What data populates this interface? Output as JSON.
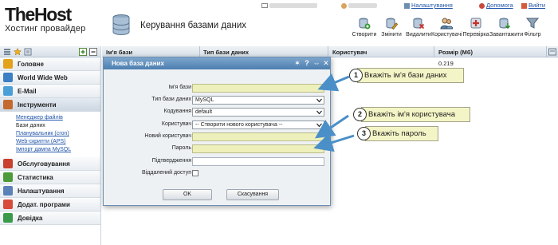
{
  "app": {
    "logo_title": "TheHost",
    "logo_subtitle": "Хостинг провайдер",
    "page_title": "Керування базами даних"
  },
  "topbar": {
    "settings": "Налаштування",
    "help": "Допомога",
    "exit": "Вийти"
  },
  "toolbar": {
    "buttons": [
      {
        "label": "Створити",
        "icon": "create-icon"
      },
      {
        "label": "Змінити",
        "icon": "edit-icon"
      },
      {
        "label": "Видалити",
        "icon": "delete-icon"
      },
      {
        "label": "Користувачі",
        "icon": "users-icon"
      },
      {
        "label": "Перевірка",
        "icon": "check-icon"
      },
      {
        "label": "Завантажити",
        "icon": "download-icon"
      },
      {
        "label": "Фільтр",
        "icon": "filter-icon"
      }
    ]
  },
  "sidebar": {
    "groups": [
      {
        "label": "Головне",
        "color": "#e3a21a"
      },
      {
        "label": "World Wide Web",
        "color": "#3b7fc4"
      },
      {
        "label": "E-Mail",
        "color": "#4a9fd8"
      },
      {
        "label": "Інструменти",
        "color": "#c46a2e"
      }
    ],
    "tools_items": [
      {
        "label": "Менеджер файлів"
      },
      {
        "label": "Бази даних"
      },
      {
        "label": "Планувальник (cron)"
      },
      {
        "label": "Web-скрипти (APS)"
      },
      {
        "label": "Імпорт дампа MySQL"
      }
    ],
    "bottom_groups": [
      {
        "label": "Обслуговування",
        "color": "#c9402f"
      },
      {
        "label": "Статистика",
        "color": "#4d9a3a"
      },
      {
        "label": "Налаштування",
        "color": "#5b82b8"
      },
      {
        "label": "Додат. програми",
        "color": "#d84a3a"
      },
      {
        "label": "Довідка",
        "color": "#3a9a4a"
      }
    ]
  },
  "table": {
    "columns": [
      "Ім'я бази",
      "Тип бази даних",
      "Користувач",
      "Розмір (Мб)"
    ],
    "rows": [
      {
        "size": "0.219"
      }
    ]
  },
  "dialog": {
    "title": "Нова база даних",
    "fields": {
      "db_name": {
        "label": "Ім'я бази",
        "value": ""
      },
      "db_type": {
        "label": "Тип бази даних",
        "value": "MySQL"
      },
      "encoding": {
        "label": "Кодування",
        "value": "default"
      },
      "user": {
        "label": "Користувач",
        "value": "-- Створити нового користувача --"
      },
      "new_user": {
        "label": "Новий користувач",
        "value": ""
      },
      "password": {
        "label": "Пароль",
        "value": ""
      },
      "confirm": {
        "label": "Підтвердження",
        "value": ""
      },
      "remote_access": {
        "label": "Віддалений доступ",
        "checked": false
      }
    },
    "ok_label": "OK",
    "cancel_label": "Скасування"
  },
  "callouts": [
    {
      "number": "1",
      "text": "Вкажіть ім'я бази даних"
    },
    {
      "number": "2",
      "text": "Вкажіть ім'я користувача"
    },
    {
      "number": "3",
      "text": "Вкажіть пароль"
    }
  ]
}
